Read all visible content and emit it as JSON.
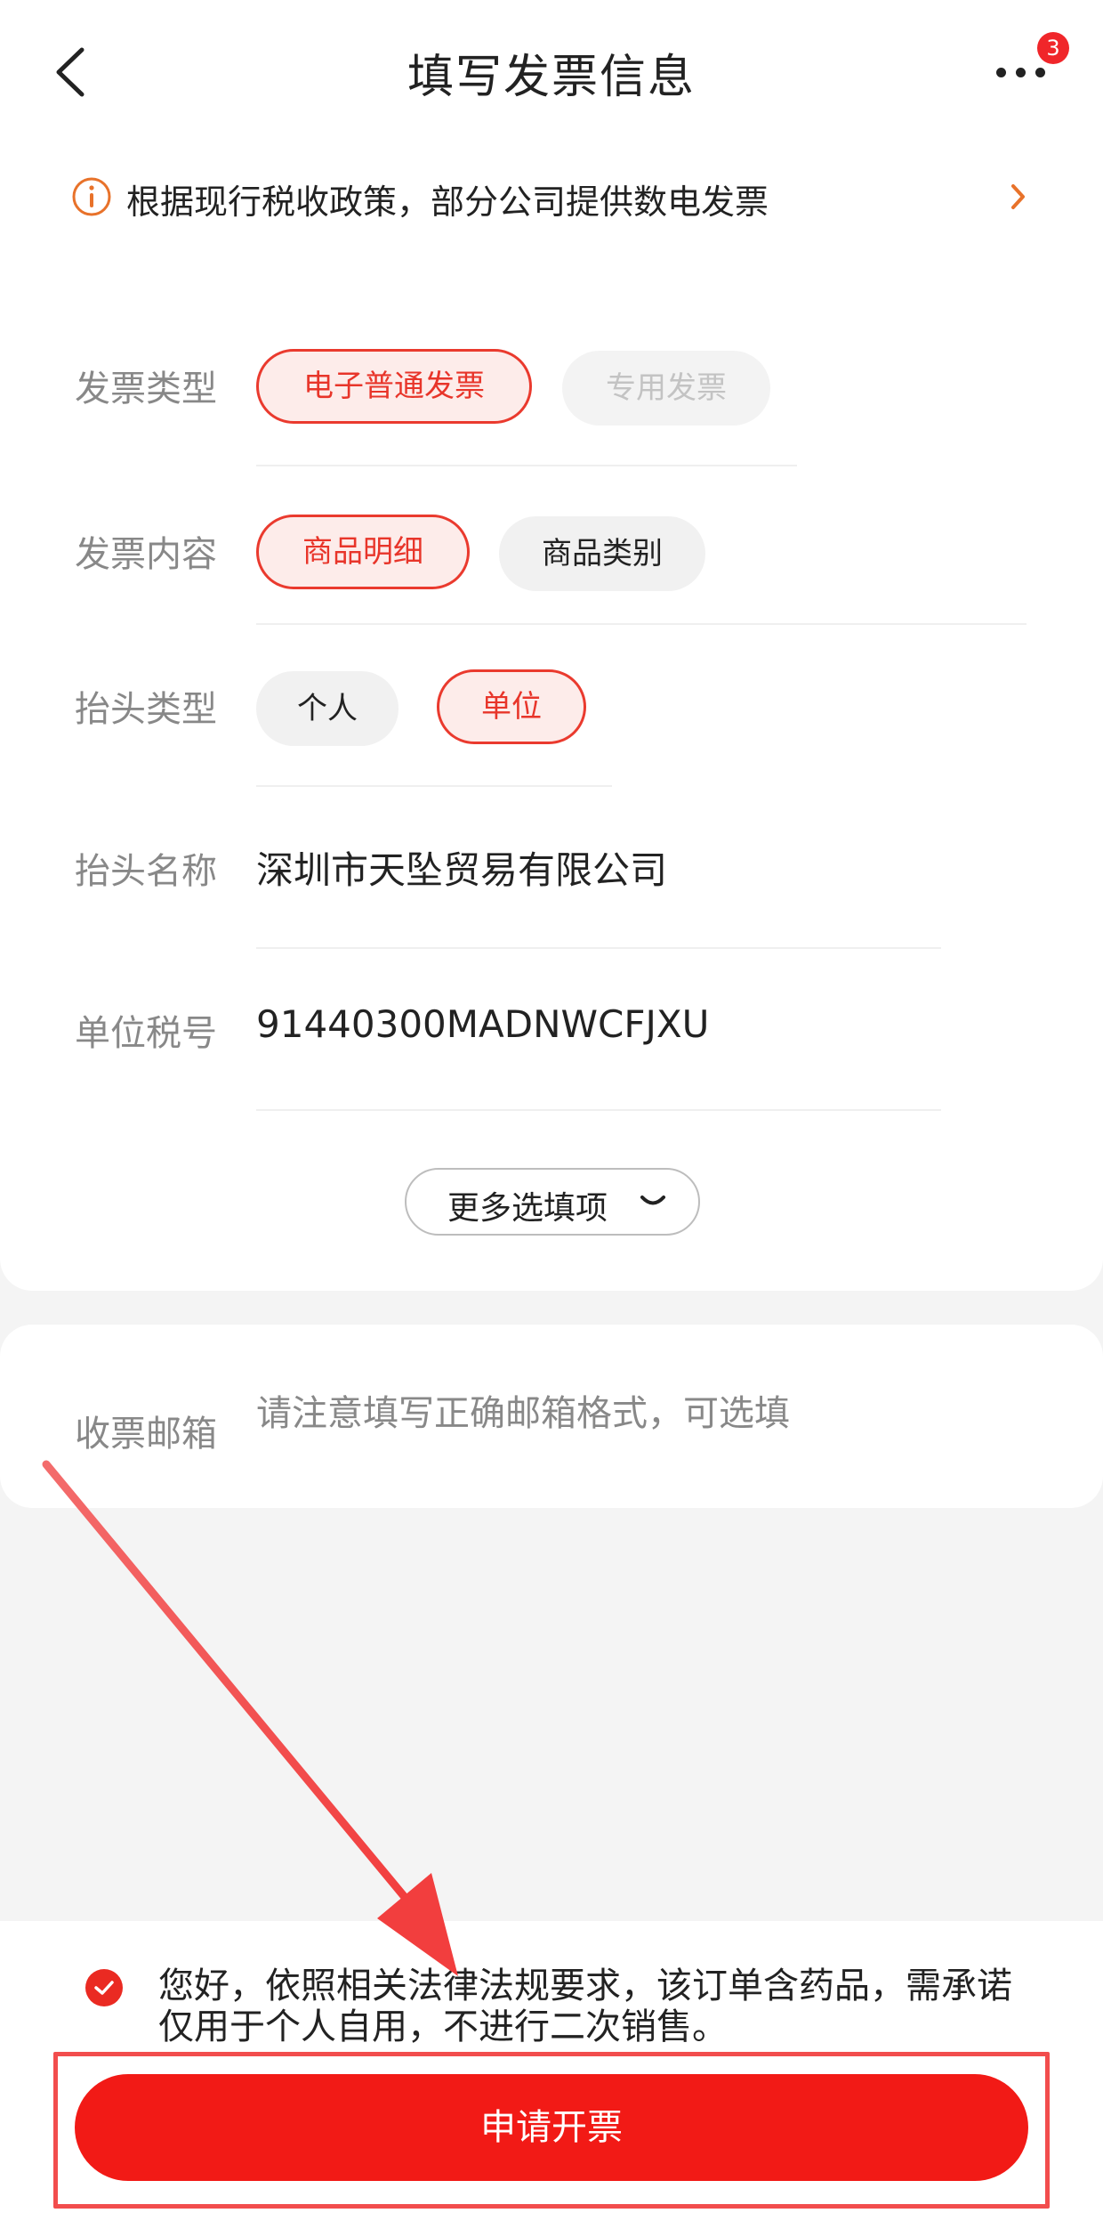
{
  "header": {
    "title": "填写发票信息",
    "back_icon": "back-chevron-icon",
    "more_icon": "more-dots-icon",
    "badge_count": "3"
  },
  "notice": {
    "text": "根据现行税收政策，部分公司提供数电发票",
    "icon": "info-icon",
    "accent": "#e8722a"
  },
  "form": {
    "invoice_type": {
      "label": "发票类型",
      "options": [
        {
          "label": "电子普通发票",
          "state": "selected"
        },
        {
          "label": "专用发票",
          "state": "disabled"
        }
      ]
    },
    "invoice_content": {
      "label": "发票内容",
      "options": [
        {
          "label": "商品明细",
          "state": "selected"
        },
        {
          "label": "商品类别",
          "state": "normal"
        }
      ]
    },
    "title_type": {
      "label": "抬头类型",
      "options": [
        {
          "label": "个人",
          "state": "normal"
        },
        {
          "label": "单位",
          "state": "selected"
        }
      ]
    },
    "title_name": {
      "label": "抬头名称",
      "value": "深圳市天坠贸易有限公司"
    },
    "tax_id": {
      "label": "单位税号",
      "value": "91440300MADNWCFJXU"
    },
    "more_options": {
      "label": "更多选填项",
      "icon": "chevron-down-icon"
    }
  },
  "email": {
    "label": "收票邮箱",
    "placeholder": "请注意填写正确邮箱格式，可选填",
    "value": ""
  },
  "footer": {
    "agreement_checked": true,
    "agreement_text": "您好，依照相关法律法规要求，该订单含药品，需承诺仅用于个人自用，不进行二次销售。",
    "submit_label": "申请开票"
  },
  "colors": {
    "brand": "#f21a16",
    "chip_selected_border": "#ea3a2e",
    "chip_selected_bg": "#fdecea",
    "annotation": "#f24d4d"
  }
}
